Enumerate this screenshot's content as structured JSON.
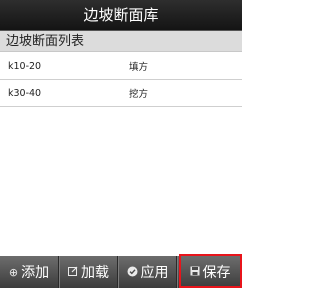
{
  "title": "边坡断面库",
  "section_header": "边坡断面列表",
  "rows": [
    {
      "name": "k10-20",
      "type": "填方"
    },
    {
      "name": "k30-40",
      "type": "挖方"
    }
  ],
  "toolbar": {
    "add": {
      "label": "添加",
      "icon": "plus-circle-icon",
      "glyph": "⊕"
    },
    "load": {
      "label": "加载",
      "icon": "edit-icon",
      "glyph": "⬚"
    },
    "apply": {
      "label": "应用",
      "icon": "check-circle-icon",
      "glyph": "✔"
    },
    "save": {
      "label": "保存",
      "icon": "floppy-disk-icon",
      "glyph": "▣"
    }
  },
  "highlight_color": "#e8141b"
}
